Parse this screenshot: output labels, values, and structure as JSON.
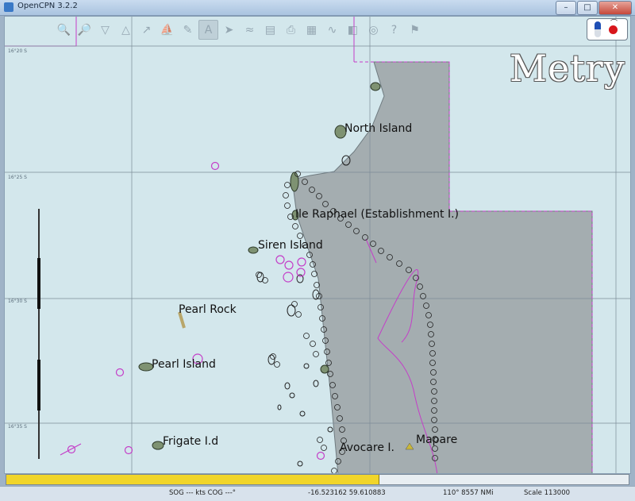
{
  "window": {
    "title": "OpenCPN 3.2.2",
    "min": "–",
    "max": "□",
    "close": "✕"
  },
  "toolbar": {
    "buttons": [
      {
        "name": "zoom-in-icon",
        "glyph": "🔍"
      },
      {
        "name": "zoom-out-icon",
        "glyph": "🔎"
      },
      {
        "name": "scale-in-icon",
        "glyph": "▽"
      },
      {
        "name": "scale-out-icon",
        "glyph": "△"
      },
      {
        "name": "route-icon",
        "glyph": "↗"
      },
      {
        "name": "auto-follow-icon",
        "glyph": "⛵"
      },
      {
        "name": "settings-icon",
        "glyph": "✎"
      },
      {
        "name": "text-icon",
        "glyph": "A"
      },
      {
        "name": "current-icon",
        "glyph": "➤"
      },
      {
        "name": "tides-icon",
        "glyph": "≈"
      },
      {
        "name": "layers-icon",
        "glyph": "▤"
      },
      {
        "name": "print-icon",
        "glyph": "⎙"
      },
      {
        "name": "route-manager-icon",
        "glyph": "▦"
      },
      {
        "name": "track-icon",
        "glyph": "∿"
      },
      {
        "name": "color-scheme-icon",
        "glyph": "◧"
      },
      {
        "name": "mob-icon",
        "glyph": "◎"
      },
      {
        "name": "help-icon",
        "glyph": "?"
      },
      {
        "name": "ais-icon",
        "glyph": "⚑"
      }
    ]
  },
  "chart": {
    "name": "Metry",
    "lat_labels": [
      "16°20 S",
      "16°25 S",
      "16°30 S",
      "16°35 S"
    ],
    "places": [
      {
        "key": "north",
        "name": "North Island"
      },
      {
        "key": "raphael",
        "name": "Ile Raphael (Establishment I.)"
      },
      {
        "key": "siren",
        "name": "Siren Island"
      },
      {
        "key": "pearlrock",
        "name": "Pearl Rock"
      },
      {
        "key": "pearlisland",
        "name": "Pearl Island"
      },
      {
        "key": "frigate",
        "name": "Frigate I.d"
      },
      {
        "key": "avocare",
        "name": "Avocare I."
      },
      {
        "key": "mapare",
        "name": "Mapare"
      }
    ]
  },
  "progress": {
    "fraction": 0.6
  },
  "status": {
    "sog_cog": "SOG --- kts  COG ---°",
    "position": "-16.523162   59.610883",
    "bearing_range": "110°   8557 NMi",
    "scale": "Scale 113000"
  },
  "colors": {
    "sea": "#d3e7ec",
    "shoal": "#a4adb0",
    "land": "#7e9272",
    "magenta": "#c43ec8",
    "progress": "#f1d52a"
  }
}
